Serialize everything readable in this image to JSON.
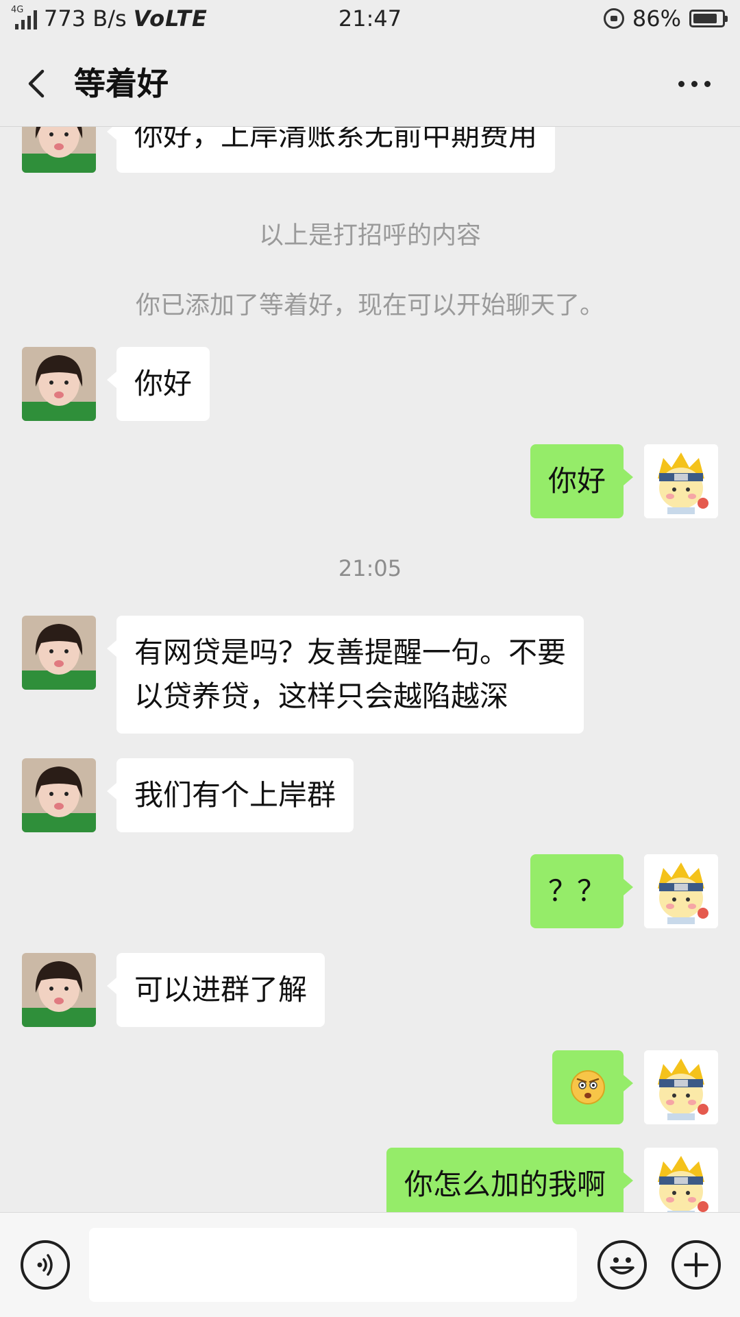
{
  "status_bar": {
    "network_speed": "773 B/s",
    "network_type": "4G",
    "volte": "VoLTE",
    "time": "21:47",
    "battery_percent": "86%",
    "battery_level": 0.86
  },
  "header": {
    "title": "等着好",
    "back_icon": "chevron-left-icon",
    "more_icon": "more-dots-icon"
  },
  "messages": {
    "m1": "你好，上岸清账系无前中期费用",
    "sys1": "以上是打招呼的内容",
    "sys2": "你已添加了等着好，现在可以开始聊天了。",
    "m2": "你好",
    "m3": "你好",
    "timestamp": "21:05",
    "m4_line1": "有网贷是吗？友善提醒一句。不要",
    "m4_line2": "以贷养贷，这样只会越陷越深",
    "m5": "我们有个上岸群",
    "m6": "？？",
    "m7": "可以进群了解",
    "m8_emoji": "angry-face-emoji",
    "m9": "你怎么加的我啊"
  },
  "colors": {
    "background": "#ededed",
    "outgoing_bubble": "#95ec69",
    "incoming_bubble": "#ffffff"
  },
  "input_bar": {
    "voice_icon": "voice-icon",
    "emoji_icon": "smiley-icon",
    "plus_icon": "plus-icon"
  }
}
